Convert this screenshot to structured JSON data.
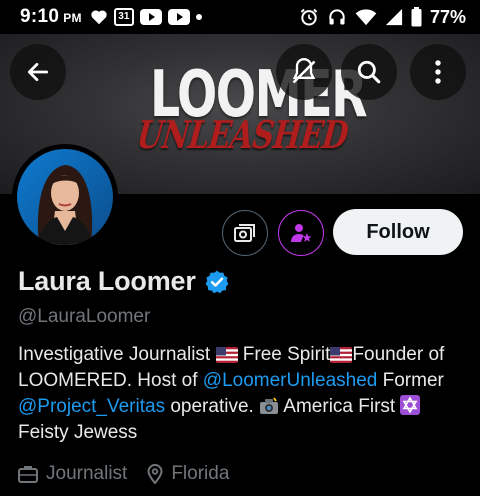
{
  "status_bar": {
    "time": "9:10",
    "ampm": "PM",
    "calendar_day": "31",
    "battery": "77%"
  },
  "banner": {
    "title": "LOOMER",
    "subtitle": "UNLEASHED"
  },
  "profile": {
    "display_name": "Laura Loomer",
    "handle": "@LauraLoomer",
    "verified": true,
    "follow_label": "Follow",
    "bio": {
      "part1": "Investigative Journalist ",
      "part2": " Free Spirit",
      "part3": "Founder of LOOMERED. Host of ",
      "link1": "@LoomerUnleashed",
      "part4": " Former ",
      "link2": "@Project_Veritas",
      "part5": " operative. ",
      "part6": " America First ",
      "part7": " Feisty Jewess"
    },
    "profession": "Journalist",
    "location": "Florida"
  },
  "colors": {
    "link": "#1d9bf0",
    "verified": "#1d9bf0",
    "muted": "#71767b",
    "follow_bg": "#eff3f4",
    "accent_purple": "#c039e8"
  },
  "icons": [
    "back-arrow-icon",
    "no-notifications-icon",
    "search-icon",
    "more-vertical-icon",
    "subscription-icon",
    "subscribe-creator-icon",
    "verified-badge-icon",
    "briefcase-icon",
    "location-pin-icon"
  ]
}
